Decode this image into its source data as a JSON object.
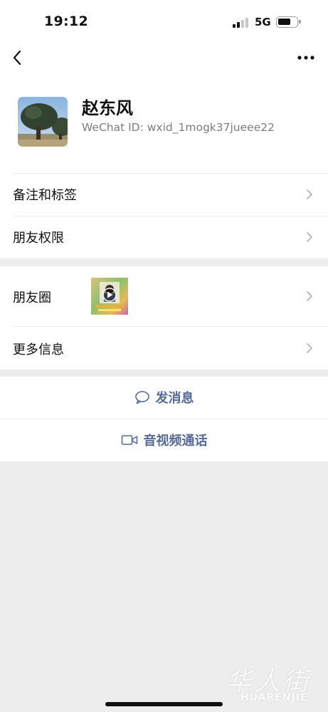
{
  "status_bar": {
    "time": "19:12",
    "network": "5G",
    "signal_bars_active": 2,
    "signal_bars_total": 4,
    "battery_level": 0.6
  },
  "nav": {
    "back_icon": "chevron-left-icon",
    "more_icon": "more-dots-icon"
  },
  "profile": {
    "name": "赵东风",
    "wechat_id": "WeChat ID: wxid_1mogk37jueee22",
    "avatar": "tree-photo-avatar"
  },
  "settings": {
    "remarks_label": "备注和标签",
    "permissions_label": "朋友权限"
  },
  "info": {
    "moments_label": "朋友圈",
    "more_info_label": "更多信息",
    "moments_thumb": "video-thumbnail"
  },
  "actions": {
    "message_label": "发消息",
    "call_label": "音视频通话"
  },
  "watermark": {
    "chars": "华人街",
    "latin": "HUARENJIE"
  },
  "colors": {
    "link": "#576b95",
    "background": "#ededed",
    "card": "#ffffff",
    "secondary_text": "#7d7d7d"
  }
}
